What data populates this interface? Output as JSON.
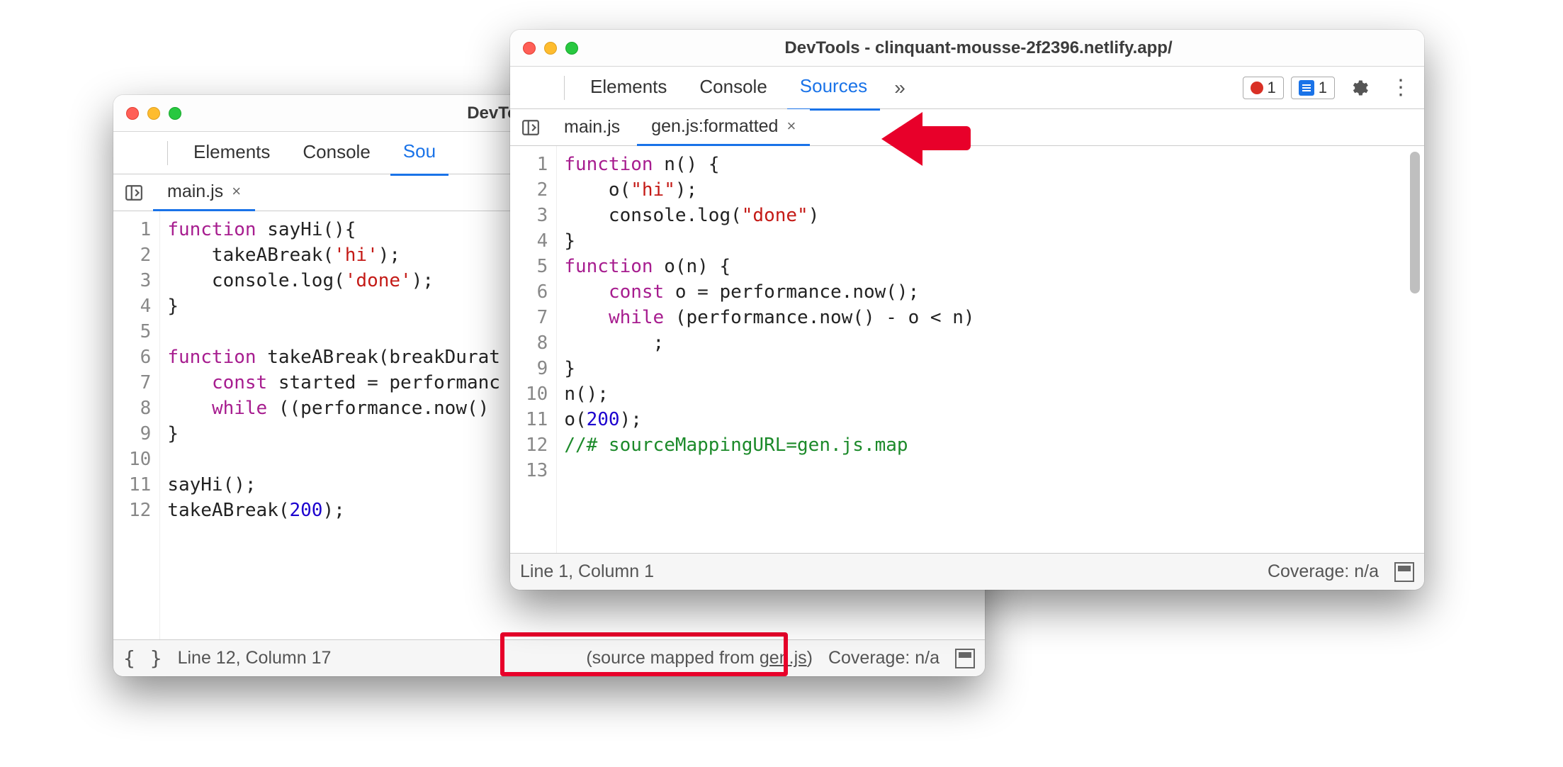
{
  "window_back": {
    "title": "DevTools - clinquant-m",
    "tabs": [
      "Elements",
      "Console",
      "Sou"
    ],
    "active_tab_index": 2,
    "file_tabs": [
      {
        "label": "main.js",
        "closeable": true,
        "active": true
      }
    ],
    "code_lines": [
      {
        "n": "1",
        "tokens": [
          {
            "t": "function ",
            "c": "kw"
          },
          {
            "t": "sayHi(){"
          }
        ]
      },
      {
        "n": "2",
        "tokens": [
          {
            "t": "    takeABreak("
          },
          {
            "t": "'hi'",
            "c": "str"
          },
          {
            "t": ");"
          }
        ]
      },
      {
        "n": "3",
        "tokens": [
          {
            "t": "    console.log("
          },
          {
            "t": "'done'",
            "c": "str"
          },
          {
            "t": ");"
          }
        ]
      },
      {
        "n": "4",
        "tokens": [
          {
            "t": "}"
          }
        ]
      },
      {
        "n": "5",
        "tokens": [
          {
            "t": ""
          }
        ]
      },
      {
        "n": "6",
        "tokens": [
          {
            "t": "function ",
            "c": "kw"
          },
          {
            "t": "takeABreak(breakDurat"
          }
        ]
      },
      {
        "n": "7",
        "tokens": [
          {
            "t": "    "
          },
          {
            "t": "const ",
            "c": "kw"
          },
          {
            "t": "started = performanc"
          }
        ]
      },
      {
        "n": "8",
        "tokens": [
          {
            "t": "    "
          },
          {
            "t": "while ",
            "c": "kw"
          },
          {
            "t": "((performance.now()"
          }
        ]
      },
      {
        "n": "9",
        "tokens": [
          {
            "t": "}"
          }
        ]
      },
      {
        "n": "10",
        "tokens": [
          {
            "t": ""
          }
        ]
      },
      {
        "n": "11",
        "tokens": [
          {
            "t": "sayHi();"
          }
        ]
      },
      {
        "n": "12",
        "tokens": [
          {
            "t": "takeABreak("
          },
          {
            "t": "200",
            "c": "num"
          },
          {
            "t": ");"
          }
        ]
      }
    ],
    "status_cursor": "Line 12, Column 17",
    "status_mapped_prefix": "(source mapped from ",
    "status_mapped_link": "gen.js",
    "status_mapped_suffix": ")",
    "status_coverage": "Coverage: n/a"
  },
  "window_front": {
    "title": "DevTools - clinquant-mousse-2f2396.netlify.app/",
    "tabs": [
      "Elements",
      "Console",
      "Sources"
    ],
    "active_tab_index": 2,
    "more_glyph": "»",
    "error_count": "1",
    "message_count": "1",
    "file_tabs": [
      {
        "label": "main.js",
        "closeable": false,
        "active": false
      },
      {
        "label": "gen.js:formatted",
        "closeable": true,
        "active": true
      }
    ],
    "code_lines": [
      {
        "n": "1",
        "tokens": [
          {
            "t": "function ",
            "c": "kw"
          },
          {
            "t": "n() {"
          }
        ]
      },
      {
        "n": "2",
        "tokens": [
          {
            "t": "    o("
          },
          {
            "t": "\"hi\"",
            "c": "str"
          },
          {
            "t": ");"
          }
        ]
      },
      {
        "n": "3",
        "tokens": [
          {
            "t": "    console.log("
          },
          {
            "t": "\"done\"",
            "c": "str"
          },
          {
            "t": ")"
          }
        ]
      },
      {
        "n": "4",
        "tokens": [
          {
            "t": "}"
          }
        ]
      },
      {
        "n": "5",
        "tokens": [
          {
            "t": "function ",
            "c": "kw"
          },
          {
            "t": "o(n) {"
          }
        ]
      },
      {
        "n": "6",
        "tokens": [
          {
            "t": "    "
          },
          {
            "t": "const ",
            "c": "kw"
          },
          {
            "t": "o = performance.now();"
          }
        ]
      },
      {
        "n": "7",
        "tokens": [
          {
            "t": "    "
          },
          {
            "t": "while ",
            "c": "kw"
          },
          {
            "t": "(performance.now() - o < n)"
          }
        ]
      },
      {
        "n": "8",
        "tokens": [
          {
            "t": "        ;"
          }
        ]
      },
      {
        "n": "9",
        "tokens": [
          {
            "t": "}"
          }
        ]
      },
      {
        "n": "10",
        "tokens": [
          {
            "t": "n();"
          }
        ]
      },
      {
        "n": "11",
        "tokens": [
          {
            "t": "o("
          },
          {
            "t": "200",
            "c": "num"
          },
          {
            "t": ");"
          }
        ]
      },
      {
        "n": "12",
        "tokens": [
          {
            "t": "//# sourceMappingURL=gen.js.map",
            "c": "com"
          }
        ]
      },
      {
        "n": "13",
        "tokens": [
          {
            "t": ""
          }
        ]
      }
    ],
    "status_cursor": "Line 1, Column 1",
    "status_coverage": "Coverage: n/a"
  }
}
